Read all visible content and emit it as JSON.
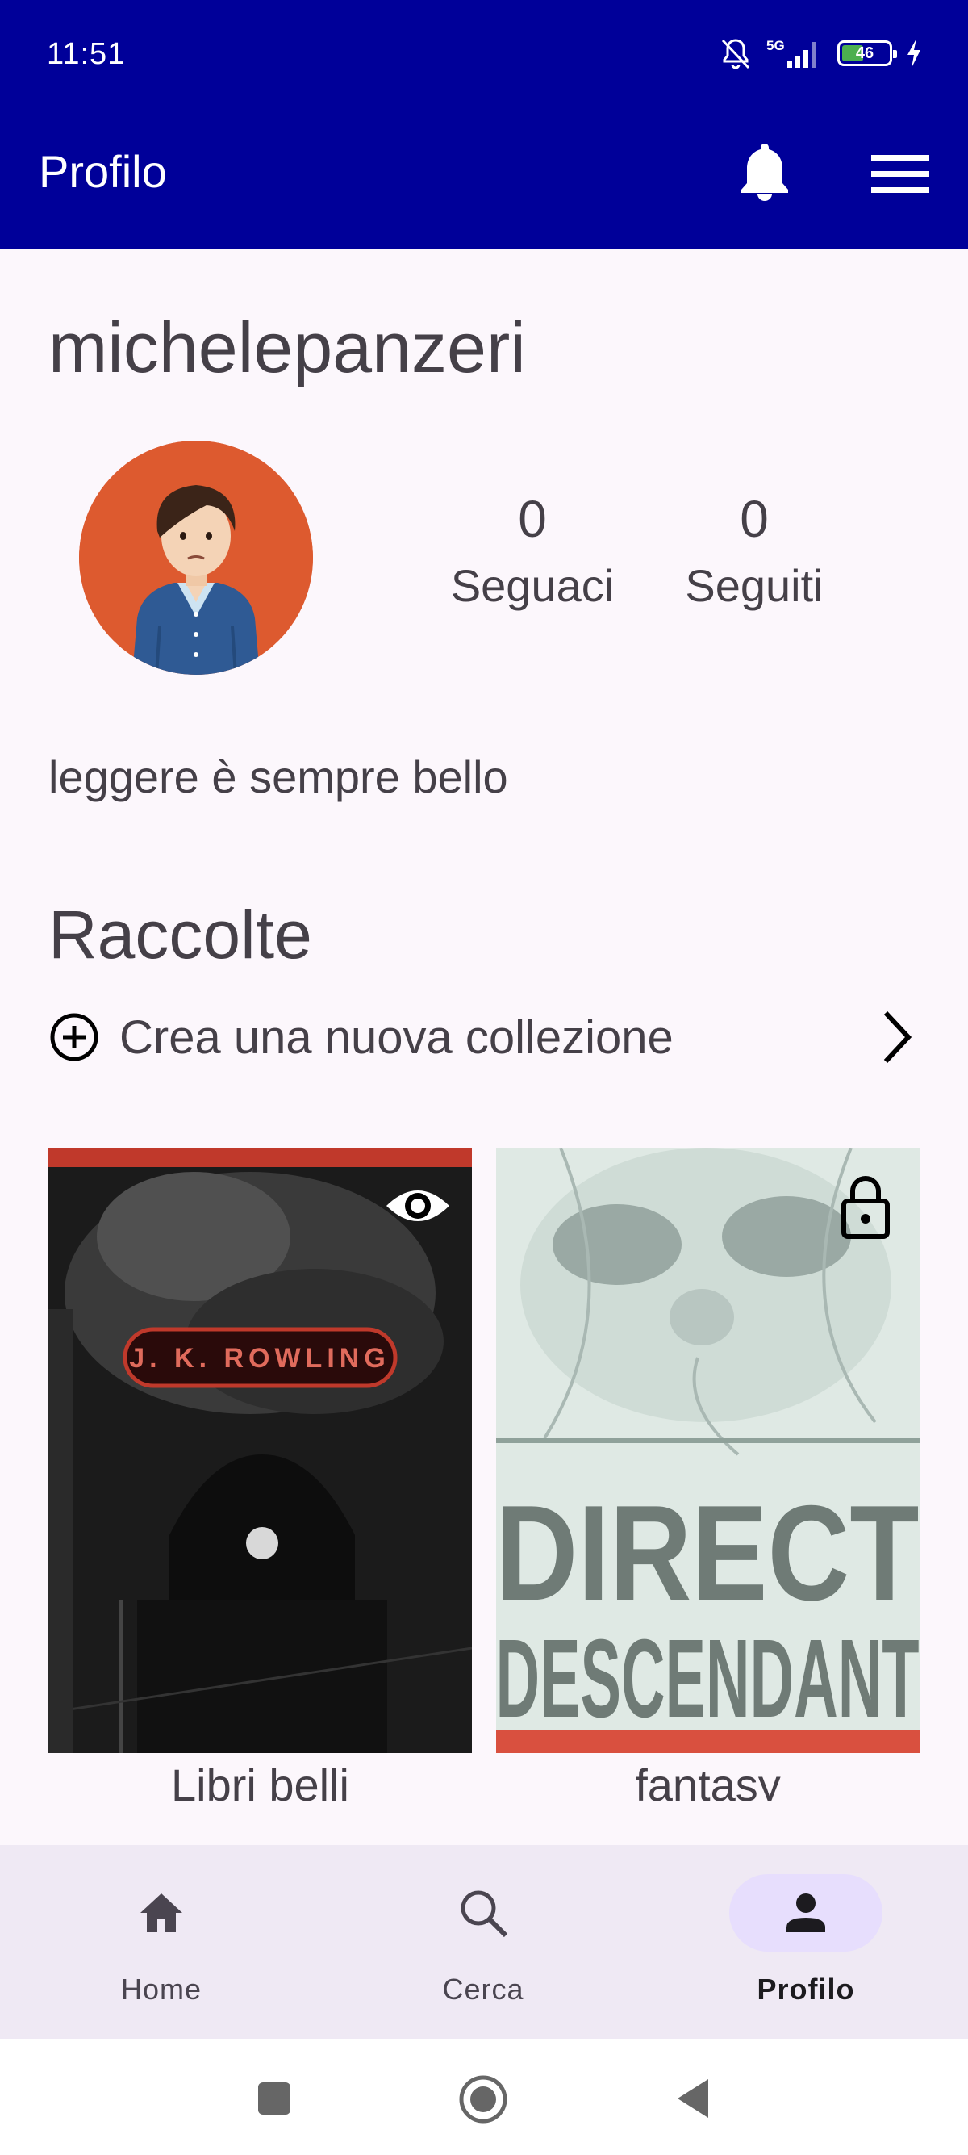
{
  "status_bar": {
    "time": "11:51",
    "network": "5G",
    "battery": "46"
  },
  "app_bar": {
    "title": "Profilo",
    "notifications_icon": "bell-icon",
    "menu_icon": "hamburger-menu-icon"
  },
  "profile": {
    "username": "michelepanzeri",
    "followers_count": "0",
    "followers_label": "Seguaci",
    "following_count": "0",
    "following_label": "Seguiti",
    "bio": "leggere è sempre bello"
  },
  "collections": {
    "title": "Raccolte",
    "create_label": "Crea una nuova collezione",
    "items": [
      {
        "name": "Libri belli",
        "visibility": "public",
        "visibility_icon": "eye-icon",
        "cover_author": "J. K. ROWLING"
      },
      {
        "name": "fantasy",
        "visibility": "private",
        "visibility_icon": "lock-icon",
        "cover_text": [
          "DIRECT",
          "DESCENDANT"
        ]
      }
    ]
  },
  "bottom_nav": {
    "items": [
      {
        "label": "Home",
        "icon": "home-icon"
      },
      {
        "label": "Cerca",
        "icon": "search-icon"
      },
      {
        "label": "Profilo",
        "icon": "person-icon",
        "active": true
      }
    ]
  },
  "colors": {
    "primary": "#000099",
    "background": "#fcf7fc",
    "nav_background": "#efe9f4",
    "active_pill": "#e7defd",
    "text": "#454048"
  }
}
